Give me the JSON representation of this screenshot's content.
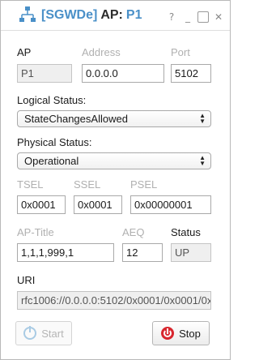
{
  "title": {
    "group": "[SGWDe]",
    "ap_label": "AP:",
    "ap_value": "P1"
  },
  "titlebar_buttons": {
    "help": "?",
    "minimize": "_",
    "maximize": "□",
    "close": "✕"
  },
  "labels": {
    "ap": "AP",
    "address": "Address",
    "port": "Port",
    "logical_status": "Logical Status:",
    "physical_status": "Physical Status:",
    "tsel": "TSEL",
    "ssel": "SSEL",
    "psel": "PSEL",
    "ap_title": "AP-Title",
    "aeq": "AEQ",
    "status": "Status",
    "uri": "URI"
  },
  "fields": {
    "ap": "P1",
    "address": "0.0.0.0",
    "port": "5102",
    "tsel": "0x0001",
    "ssel": "0x0001",
    "psel": "0x00000001",
    "ap_title": "1,1,1,999,1",
    "aeq": "12",
    "status": "UP",
    "uri": "rfc1006://0.0.0.0:5102/0x0001/0x0001/0x"
  },
  "selects": {
    "logical_status": "StateChangesAllowed",
    "physical_status": "Operational"
  },
  "buttons": {
    "start": "Start",
    "stop": "Stop"
  },
  "icons": {
    "app": "network-icon",
    "start": "power-icon",
    "stop": "power-icon"
  }
}
